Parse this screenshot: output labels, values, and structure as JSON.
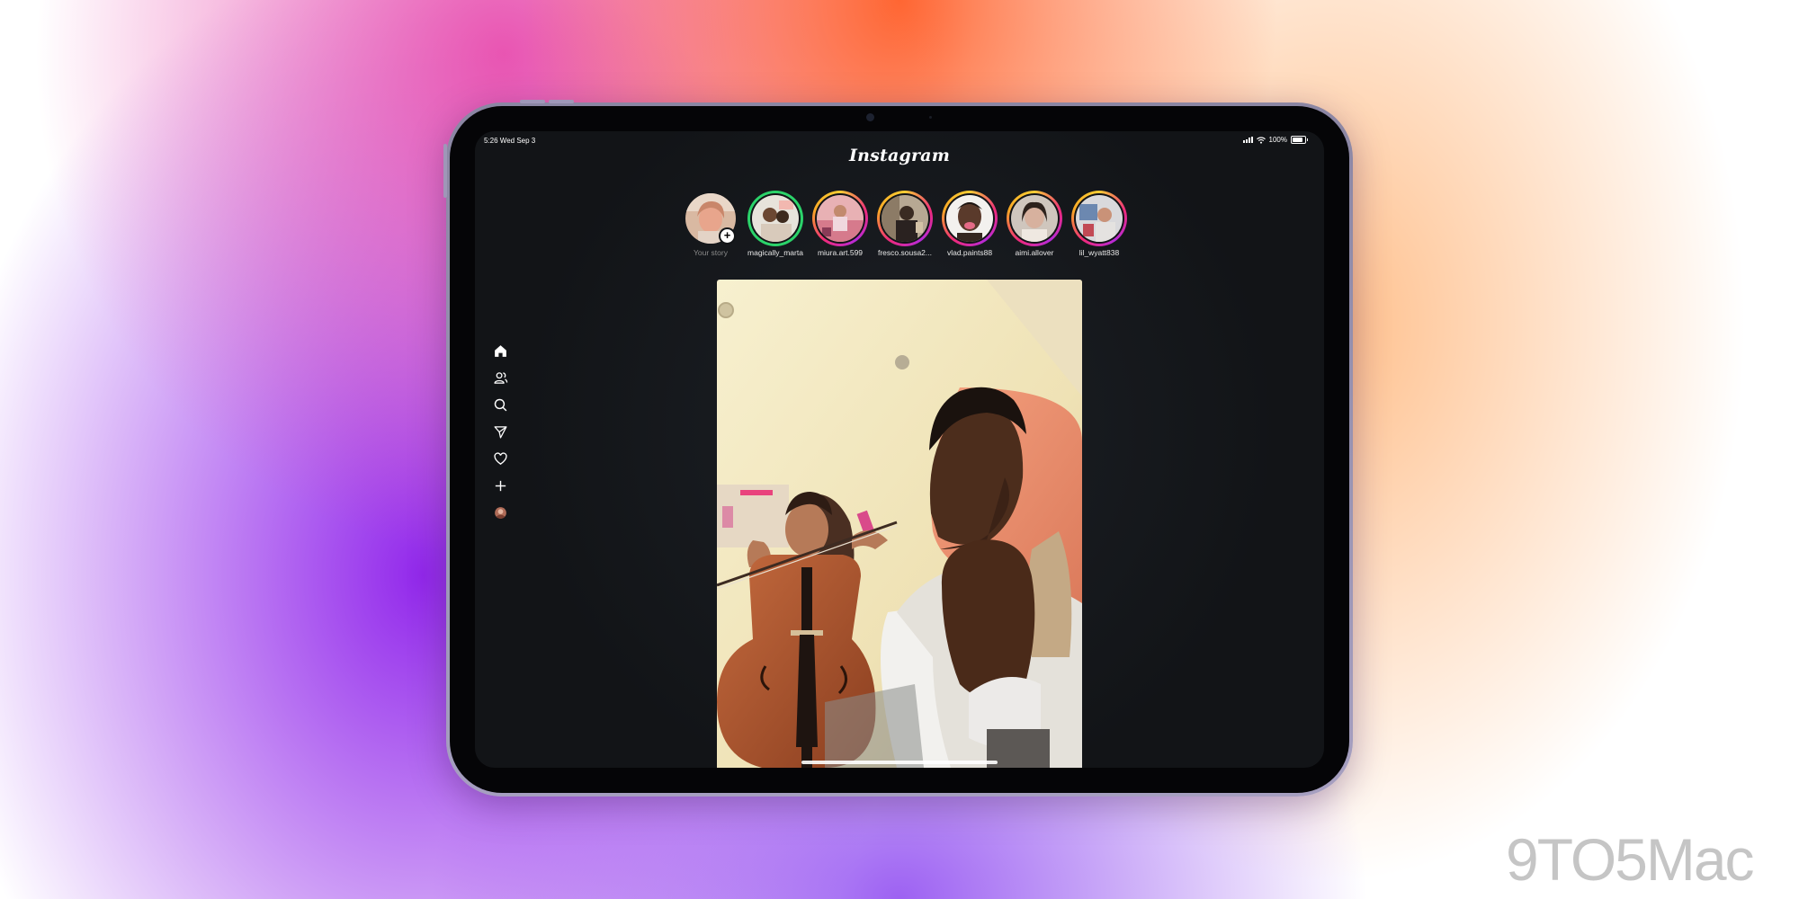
{
  "status_bar": {
    "time_date": "5:26  Wed Sep 3",
    "battery": "100%",
    "battery_level": 1.0
  },
  "app": {
    "logo_text": "Instagram"
  },
  "stories": [
    {
      "label": "Your story",
      "type": "own"
    },
    {
      "label": "magically_marta",
      "type": "close-friends"
    },
    {
      "label": "miura.art.599",
      "type": "unseen"
    },
    {
      "label": "fresco.sousa2...",
      "type": "unseen"
    },
    {
      "label": "vlad.paints88",
      "type": "unseen"
    },
    {
      "label": "aimi.allover",
      "type": "unseen"
    },
    {
      "label": "lil_wyatt838",
      "type": "unseen"
    }
  ],
  "sidebar": {
    "items": [
      {
        "name": "home",
        "icon": "home-icon",
        "active": true
      },
      {
        "name": "people",
        "icon": "people-icon"
      },
      {
        "name": "search",
        "icon": "search-icon"
      },
      {
        "name": "messages",
        "icon": "send-icon"
      },
      {
        "name": "notifications",
        "icon": "heart-icon"
      },
      {
        "name": "create",
        "icon": "plus-icon"
      },
      {
        "name": "profile",
        "icon": "avatar-icon"
      }
    ]
  },
  "post": {
    "media": "photo: two people, one playing a cello, one leaning toward the camera"
  },
  "watermark": {
    "text": "9TO5Mac"
  },
  "colors": {
    "screen_bg": "#121417",
    "story_gradient_start": "#f9ce34",
    "story_gradient_mid": "#ee2a7b",
    "close_friends_ring": "#2bd36a",
    "frame": "#a69fc0"
  }
}
